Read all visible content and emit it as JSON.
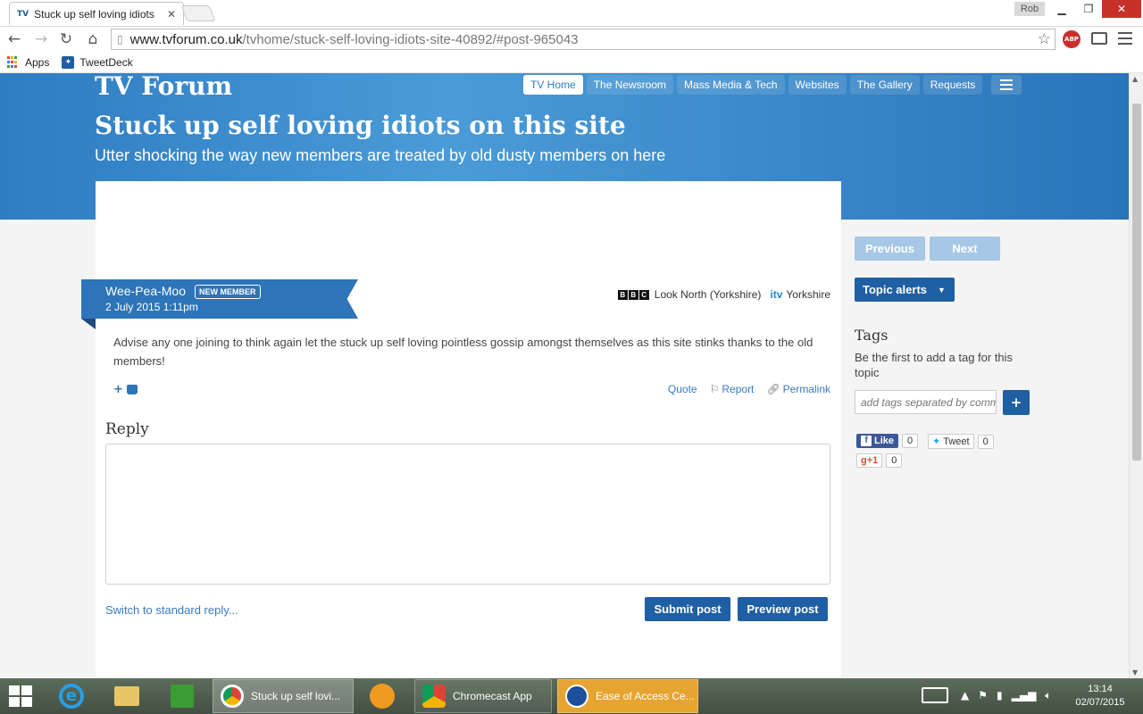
{
  "browser": {
    "tab_title": "Stuck up self loving idiots",
    "tab_favicon": "TV",
    "profile_name": "Rob",
    "url_host": "www.tvforum.co.uk",
    "url_path": "/tvhome/stuck-self-loving-idiots-site-40892/#post-965043",
    "adblock_label": "ABP",
    "bookmarks": [
      {
        "label": "Apps",
        "icon": "apps-grid-icon"
      },
      {
        "label": "TweetDeck",
        "icon": "tweetdeck-icon"
      }
    ]
  },
  "site": {
    "logo": "TV Forum",
    "nav": [
      {
        "label": "TV Home",
        "active": true
      },
      {
        "label": "The Newsroom",
        "active": false
      },
      {
        "label": "Mass Media & Tech",
        "active": false
      },
      {
        "label": "Websites",
        "active": false
      },
      {
        "label": "The Gallery",
        "active": false
      },
      {
        "label": "Requests",
        "active": false
      }
    ],
    "brand_color": "#2e7cc2"
  },
  "topic": {
    "title": "Stuck up self loving idiots on this site",
    "subtitle": "Utter shocking the way new members are treated by old dusty members on here"
  },
  "post": {
    "author": "Wee-Pea-Moo",
    "badge": "NEW MEMBER",
    "date": "2 July 2015 1:11pm",
    "channel_bbc": "Look North (Yorkshire)",
    "channel_itv_logo": "itv",
    "channel_itv": "Yorkshire",
    "body": "Advise any one joining to think again let the stuck up self loving pointless gossip amongst themselves as this site stinks thanks to the old members!",
    "like_plus": "+",
    "actions": {
      "quote": "Quote",
      "report": "Report",
      "permalink": "Permalink"
    }
  },
  "reply": {
    "heading": "Reply",
    "textarea_value": "",
    "switch_link": "Switch to standard reply...",
    "submit": "Submit post",
    "preview": "Preview post"
  },
  "sidebar": {
    "previous": "Previous",
    "next": "Next",
    "topic_alerts": "Topic alerts",
    "tags_heading": "Tags",
    "tags_text": "Be the first to add a tag for this topic",
    "tags_placeholder": "add tags separated by comma",
    "tags_add": "+",
    "fb_like": "Like",
    "fb_count": "0",
    "tweet": "Tweet",
    "tweet_count": "0",
    "gplus": "+1",
    "gplus_count": "0"
  },
  "taskbar": {
    "tasks": [
      {
        "label": "Stuck up self lovi...",
        "icon": "chrome-icon",
        "active": true
      },
      {
        "label": "Chromecast App",
        "icon": "chromecast-icon",
        "active": false
      },
      {
        "label": "Ease of Access Ce...",
        "icon": "ease-of-access-icon",
        "active": false
      }
    ],
    "time": "13:14",
    "date": "02/07/2015"
  }
}
